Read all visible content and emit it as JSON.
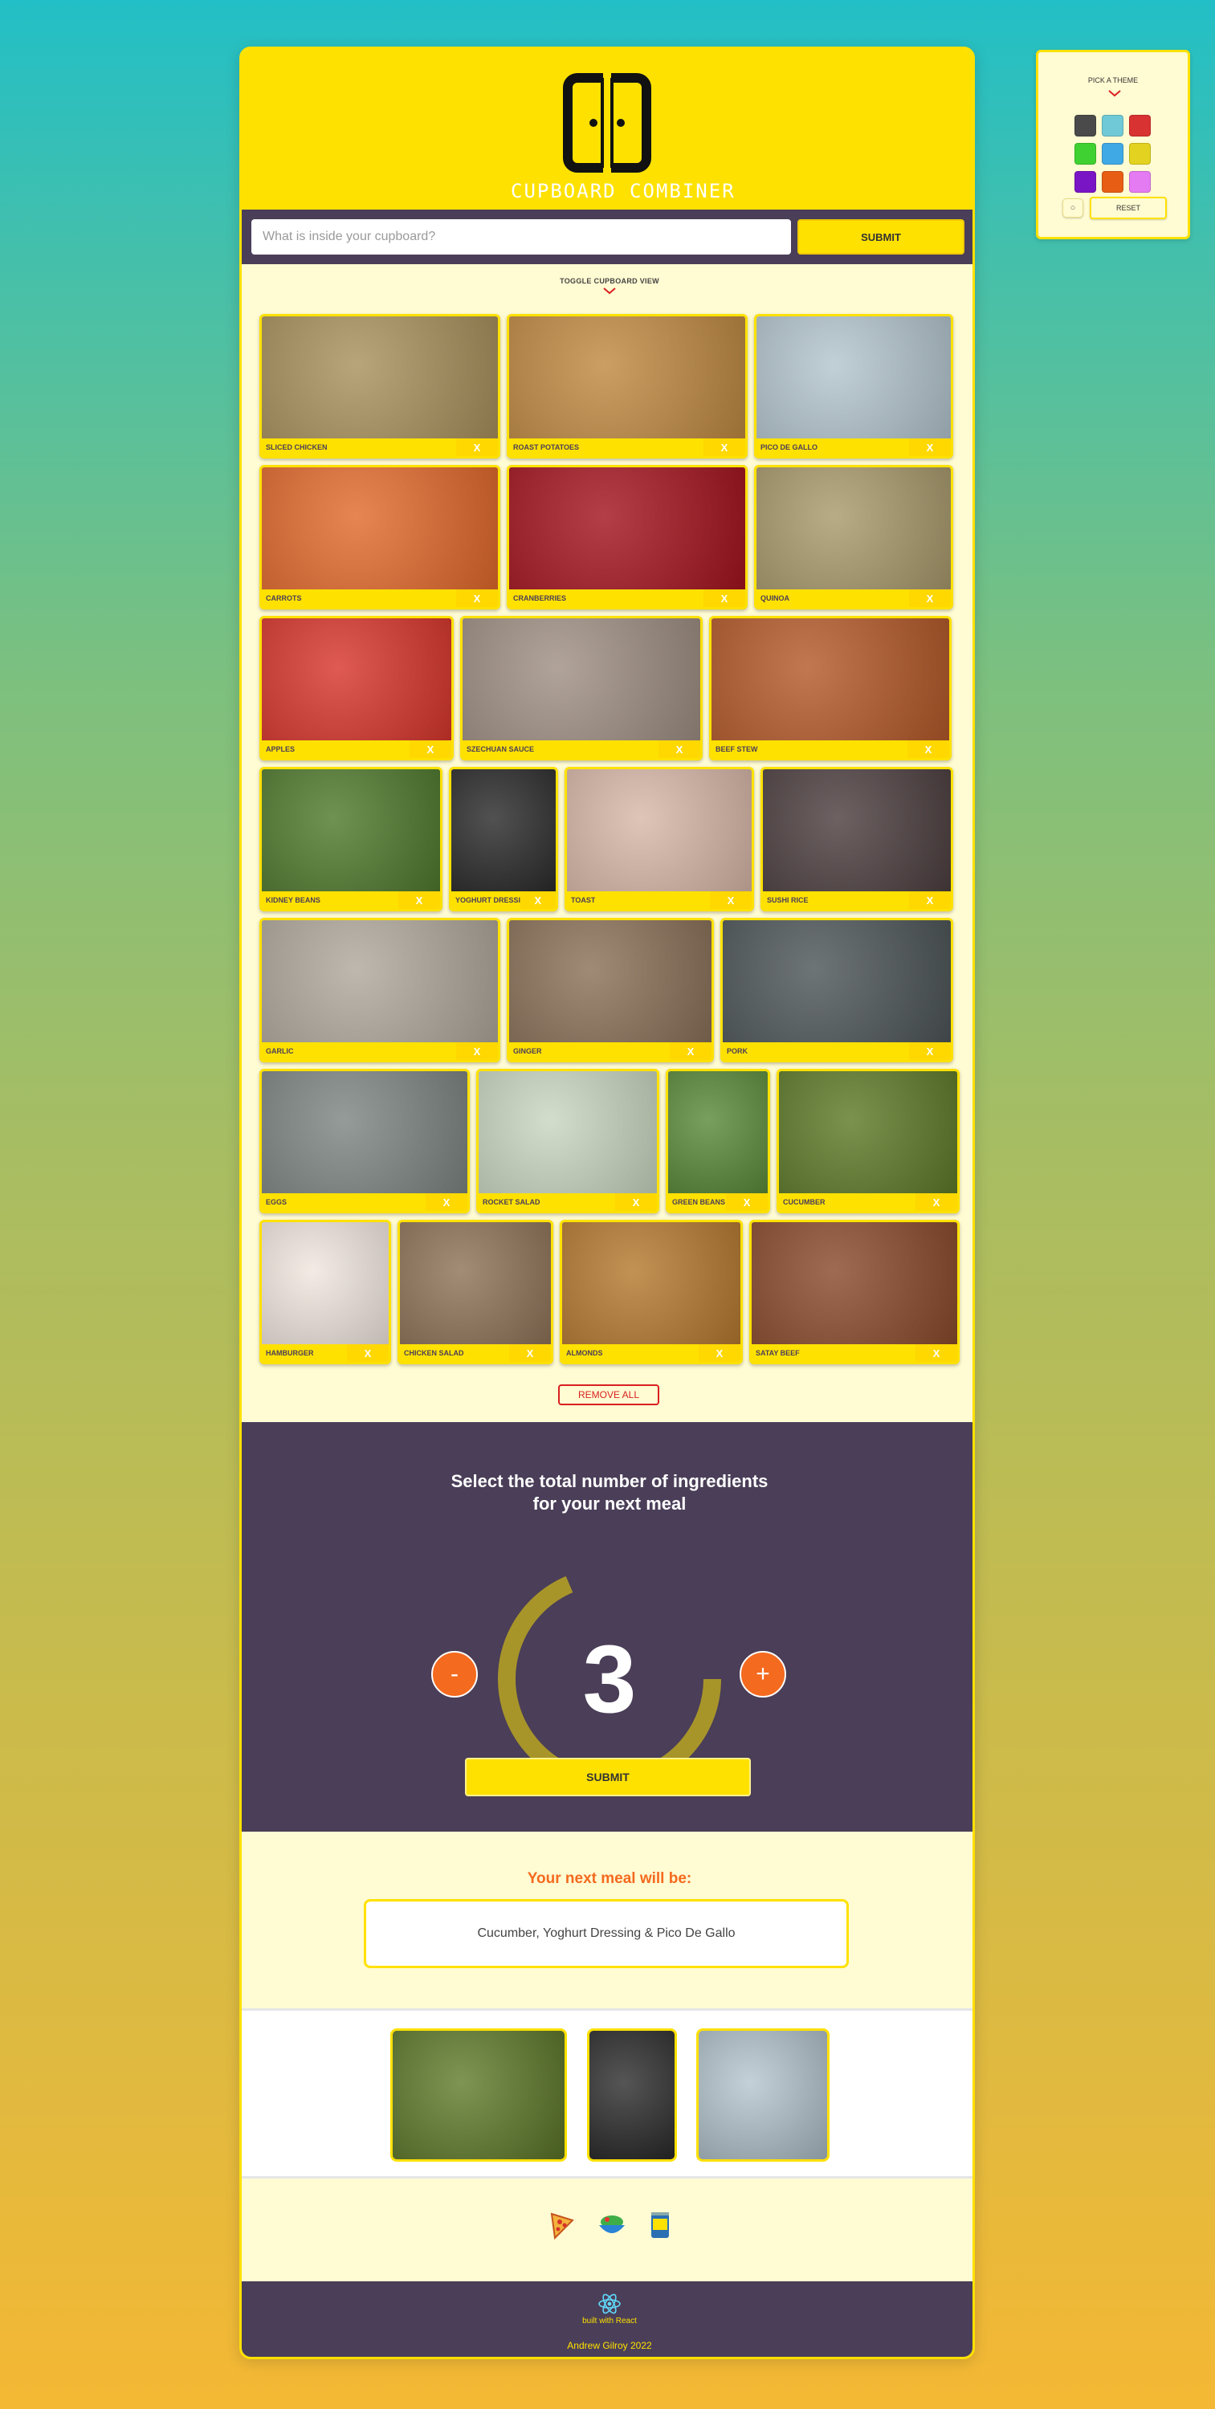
{
  "header": {
    "logo_text": "CUPBOARD COMBINER"
  },
  "search": {
    "placeholder": "What is inside your cupboard?",
    "value": "",
    "submit_label": "SUBMIT"
  },
  "toggle": {
    "label": "TOGGLE CUPBOARD VIEW"
  },
  "cupboard": {
    "rows": [
      [
        {
          "label": "SLICED CHICKEN",
          "x": "X",
          "color": "#a9915c"
        },
        {
          "label": "ROAST POTATOES",
          "x": "X",
          "color": "#c08a42"
        },
        {
          "label": "PICO DE GALLO",
          "x": "X",
          "color": "#b4c5cf"
        }
      ],
      [
        {
          "label": "CARROTS",
          "x": "X",
          "color": "#e26a2c"
        },
        {
          "label": "CRANBERRIES",
          "x": "X",
          "color": "#a4141f"
        },
        {
          "label": "QUINOA",
          "x": "X",
          "color": "#a89a6c"
        }
      ],
      [
        {
          "label": "APPLES",
          "x": "X",
          "color": "#d7362c"
        },
        {
          "label": "SZECHUAN SAUCE",
          "x": "X",
          "color": "#9f8f83"
        },
        {
          "label": "BEEF STEW",
          "x": "X",
          "color": "#b45a2a"
        }
      ],
      [
        {
          "label": "KIDNEY BEANS",
          "x": "X",
          "color": "#4f7a2d"
        },
        {
          "label": "YOGHURT DRESSING",
          "x": "X",
          "color": "#2b2b2b"
        },
        {
          "label": "TOAST",
          "x": "X",
          "color": "#d8b7a8"
        },
        {
          "label": "SUSHI RICE",
          "x": "X",
          "color": "#4d3f40"
        }
      ],
      [
        {
          "label": "GARLIC",
          "x": "X",
          "color": "#b0a89c"
        },
        {
          "label": "GINGER",
          "x": "X",
          "color": "#8a7158"
        },
        {
          "label": "PORK",
          "x": "X",
          "color": "#4e5658"
        }
      ],
      [
        {
          "label": "EGGS",
          "x": "X",
          "color": "#7d8582"
        },
        {
          "label": "ROCKET SALAD",
          "x": "X",
          "color": "#c9d6c1"
        },
        {
          "label": "GREEN BEANS",
          "x": "X",
          "color": "#5b8a3a"
        },
        {
          "label": "CUCUMBER",
          "x": "X",
          "color": "#5e7a28"
        }
      ],
      [
        {
          "label": "HAMBURGER",
          "x": "X",
          "color": "#f1e6df"
        },
        {
          "label": "CHICKEN SALAD",
          "x": "X",
          "color": "#8f7358"
        },
        {
          "label": "ALMONDS",
          "x": "X",
          "color": "#b5792f"
        },
        {
          "label": "SATAY BEEF",
          "x": "X",
          "color": "#8a4a2c"
        }
      ]
    ],
    "remove_all_label": "REMOVE ALL"
  },
  "selector": {
    "title_line1": "Select the total number of ingredients",
    "title_line2": "for your next meal",
    "count": "3",
    "minus_label": "-",
    "plus_label": "+",
    "submit_label": "SUBMIT"
  },
  "result": {
    "title": "Your next meal will be:",
    "meal": "Cucumber, Yoghurt Dressing & Pico De Gallo"
  },
  "meal_images": [
    {
      "icon": "cucumber-image",
      "color": "#5e7a28"
    },
    {
      "icon": "yoghurt-dressing-image",
      "color": "#2b2b2b"
    },
    {
      "icon": "pico-de-gallo-image",
      "color": "#b4c5cf"
    }
  ],
  "footer_icons": [
    "pizza-icon",
    "salad-bowl-icon",
    "canned-food-icon"
  ],
  "footer": {
    "built_with": "built with React",
    "author": "Andrew Gilroy 2022"
  },
  "theme": {
    "title": "PICK A THEME",
    "reset_label": "RESET",
    "small_button_label": "○",
    "swatches": [
      "#4a4a4a",
      "#6fc9d6",
      "#d83232",
      "#3fd131",
      "#3fa9e6",
      "#e3d21f",
      "#7a15c6",
      "#e85d14",
      "#e47bf2"
    ]
  },
  "colors": {
    "accent": "#ffe100",
    "dark": "#4a3e58",
    "orange": "#f46a1f",
    "cream": "#fffbd2"
  }
}
